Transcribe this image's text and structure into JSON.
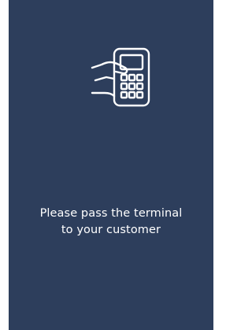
{
  "screen": {
    "background_color": "#2d3e5c",
    "text_color": "#ffffff",
    "icon": "hand-holding-payment-terminal-icon",
    "message": {
      "line1": "Please pass the terminal",
      "line2": "to your customer"
    }
  }
}
